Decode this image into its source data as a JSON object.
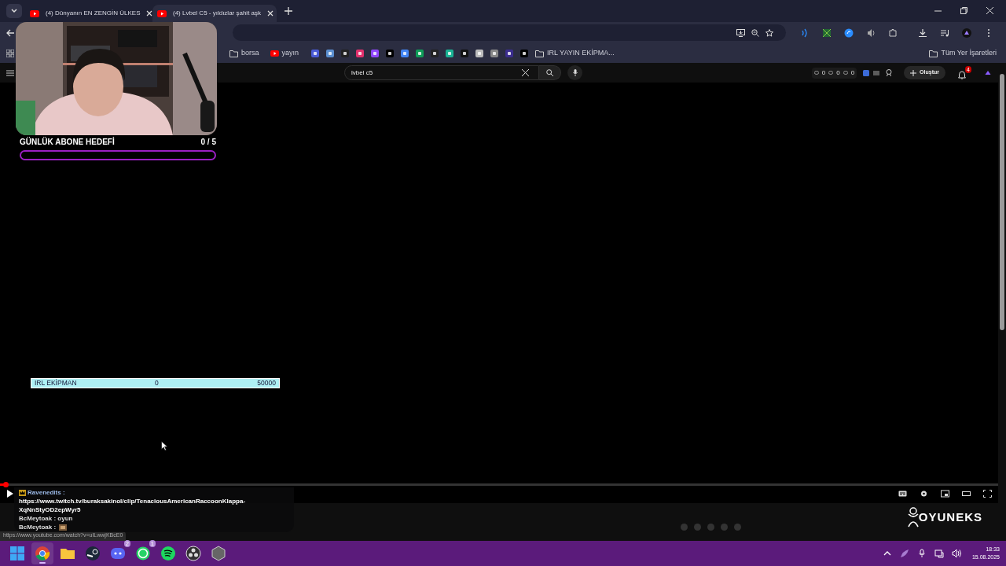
{
  "browser": {
    "tabs": [
      {
        "title": "(4) Dünyanın EN ZENGİN ÜLKES",
        "selected": false
      },
      {
        "title": "(4) Lvbel C5 - yıldızlar şahit aşk",
        "selected": true
      }
    ],
    "bookmarks": [
      {
        "kind": "folder",
        "label": "borsa"
      },
      {
        "kind": "site",
        "label": "yayın"
      },
      {
        "kind": "favicon"
      },
      {
        "kind": "favicon"
      },
      {
        "kind": "favicon"
      },
      {
        "kind": "favicon"
      },
      {
        "kind": "favicon"
      },
      {
        "kind": "favicon"
      },
      {
        "kind": "favicon"
      },
      {
        "kind": "favicon"
      },
      {
        "kind": "favicon"
      },
      {
        "kind": "favicon"
      },
      {
        "kind": "favicon"
      },
      {
        "kind": "favicon"
      },
      {
        "kind": "favicon"
      },
      {
        "kind": "favicon"
      },
      {
        "kind": "favicon"
      },
      {
        "kind": "folder",
        "label": "IRL YAYIN EKİPMA..."
      }
    ],
    "all_bookmarks": "Tüm Yer İşaretleri",
    "status_url": "https://www.youtube.com/watch?v=uILwwjKBcE0"
  },
  "youtube": {
    "search": {
      "value": "lvbel c5"
    },
    "counters": [
      "0",
      "0",
      "0"
    ],
    "create_button": "Oluştur",
    "notification_count": "4"
  },
  "stream_overlay": {
    "sub_goal": {
      "label": "GÜNLÜK ABONE HEDEFİ",
      "count": "0 / 5",
      "level": 0
    },
    "equipment_goal": {
      "label": "IRL EKİPMAN",
      "current": "0",
      "target": "50000"
    },
    "chat": [
      {
        "user": "Ravenedits :",
        "badge": true,
        "kind": "text",
        "text": "https://www.twitch.tv/buraksakinol/clip/TenaciousAmericanRaccoonKlappa-XqNnStyOD2epWyr5"
      },
      {
        "user": "BcMeytoak : oyun",
        "badge": false,
        "kind": "plain"
      },
      {
        "user": "BcMeytoak :",
        "badge": false,
        "kind": "emote"
      }
    ]
  },
  "player": {
    "progress": {
      "level": 0.004
    }
  },
  "channel_logo": "OYUNEKS",
  "taskbar": {
    "apps": [
      {
        "kind": "start",
        "active": false
      },
      {
        "kind": "chrome",
        "active": true
      },
      {
        "kind": "files",
        "active": false
      },
      {
        "kind": "steam",
        "active": false
      },
      {
        "kind": "discord",
        "active": false,
        "badge": "2"
      },
      {
        "kind": "whatsapp",
        "active": false,
        "badge": "1"
      },
      {
        "kind": "spotify",
        "active": false
      },
      {
        "kind": "obs",
        "active": false
      },
      {
        "kind": "cube",
        "active": false
      }
    ],
    "time": "18:33",
    "date": "15.08.2025"
  }
}
